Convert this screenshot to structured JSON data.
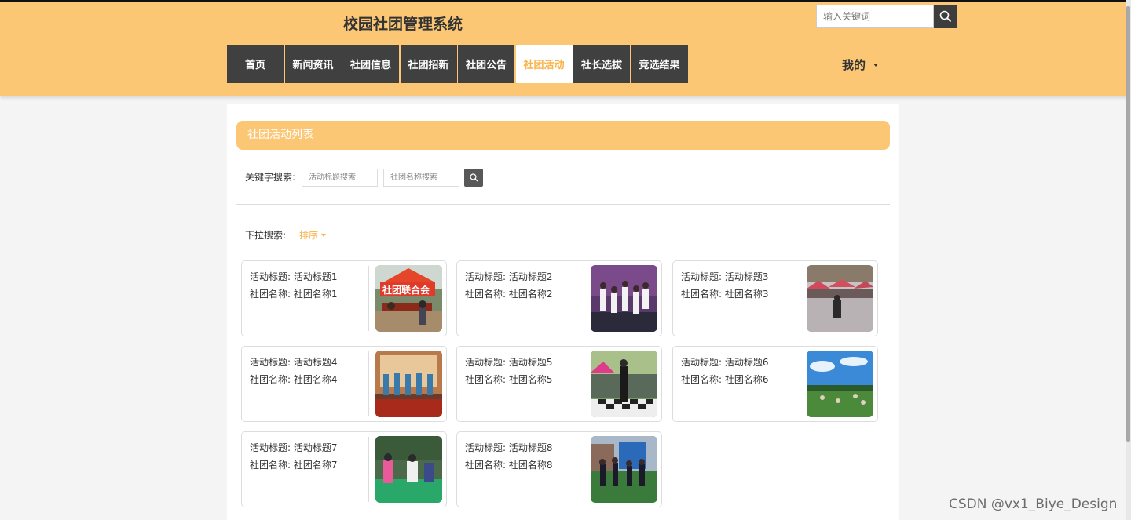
{
  "header": {
    "site_title": "校园社团管理系统",
    "search": {
      "placeholder": "输入关键词"
    },
    "nav": [
      {
        "label": "首页"
      },
      {
        "label": "新闻资讯"
      },
      {
        "label": "社团信息"
      },
      {
        "label": "社团招新"
      },
      {
        "label": "社团公告"
      },
      {
        "label": "社团活动",
        "active": true
      },
      {
        "label": "社长选拔"
      },
      {
        "label": "竞选结果"
      }
    ],
    "my_menu": "我的"
  },
  "list": {
    "title": "社团活动列表",
    "keyword_label": "关键字搜索:",
    "title_search_placeholder": "活动标题搜索",
    "club_search_placeholder": "社团名称搜索",
    "dropdown_label": "下拉搜索:",
    "sort_label": "排序"
  },
  "cards": [
    {
      "title_line": "活动标题: 活动标题1",
      "club_line": "社团名称: 社团名称1",
      "image": "club-booth-photo"
    },
    {
      "title_line": "活动标题: 活动标题2",
      "club_line": "社团名称: 社团名称2",
      "image": "dance-performance-photo"
    },
    {
      "title_line": "活动标题: 活动标题3",
      "club_line": "社团名称: 社团名称3",
      "image": "outdoor-event-photo"
    },
    {
      "title_line": "活动标题: 活动标题4",
      "club_line": "社团名称: 社团名称4",
      "image": "stage-performance-photo"
    },
    {
      "title_line": "活动标题: 活动标题5",
      "club_line": "社团名称: 社团名称5",
      "image": "street-dance-photo"
    },
    {
      "title_line": "活动标题: 活动标题6",
      "club_line": "社团名称: 社团名称6",
      "image": "lawn-gathering-photo"
    },
    {
      "title_line": "活动标题: 活动标题7",
      "club_line": "社团名称: 社团名称7",
      "image": "campus-fair-photo"
    },
    {
      "title_line": "活动标题: 活动标题8",
      "club_line": "社团名称: 社团名称8",
      "image": "group-dance-photo"
    }
  ],
  "watermark": "CSDN @vx1_Biye_Design",
  "colors": {
    "accent": "#fcc775",
    "accent_text": "#f9b349",
    "nav_dark": "#404040"
  }
}
